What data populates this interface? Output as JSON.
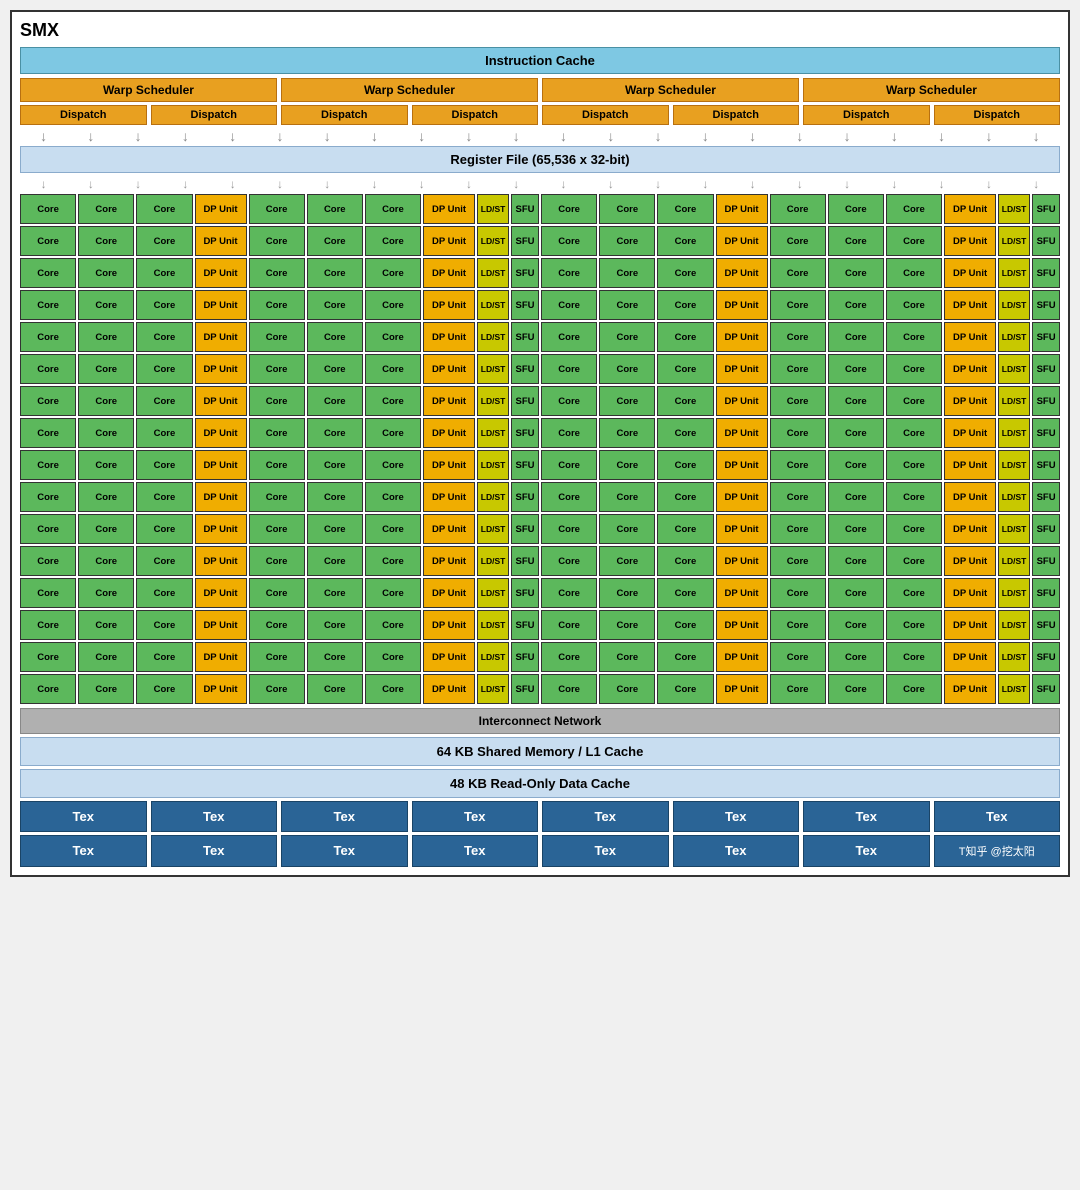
{
  "title": "SMX",
  "instruction_cache": "Instruction Cache",
  "warp_scheduler_label": "Warp Scheduler",
  "dispatch_label": "Dispatch",
  "register_file": "Register File (65,536 x 32-bit)",
  "interconnect": "Interconnect Network",
  "shared_memory": "64 KB Shared Memory / L1 Cache",
  "readonly_cache": "48 KB Read-Only Data Cache",
  "tex_label": "Tex",
  "watermark": "T知乎 @挖太阳",
  "num_rows": 16,
  "labels": {
    "core": "Core",
    "dp_unit": "DP Unit",
    "ldst": "LD/ST",
    "sfu": "SFU"
  }
}
